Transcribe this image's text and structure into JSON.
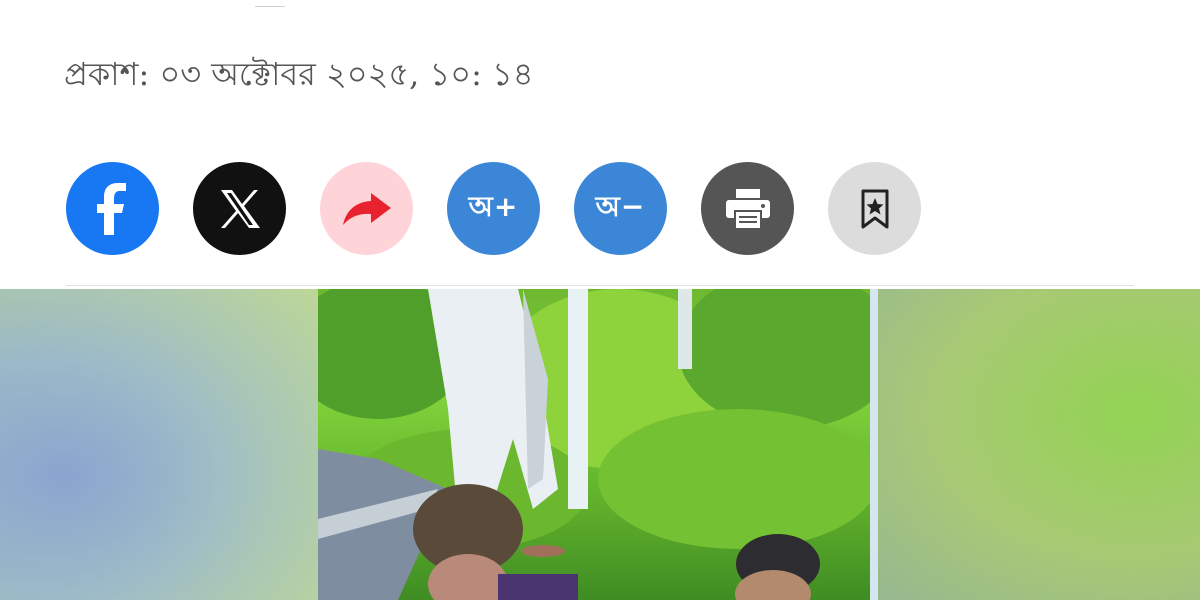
{
  "article": {
    "published_label": "প্রকাশ: ০৩ অক্টোবর ২০২৫, ১০: ১৪"
  },
  "share_bar": {
    "buttons": [
      {
        "name": "facebook",
        "icon": "facebook-icon",
        "color": "#1877f2"
      },
      {
        "name": "x",
        "icon": "x-icon",
        "color": "#111111"
      },
      {
        "name": "share",
        "icon": "share-arrow-icon",
        "color": "#ffd4d8"
      },
      {
        "name": "font-increase",
        "label": "অ+",
        "color": "#3b86d7"
      },
      {
        "name": "font-decrease",
        "label": "অ−",
        "color": "#3b86d7"
      },
      {
        "name": "print",
        "icon": "printer-icon",
        "color": "#555555"
      },
      {
        "name": "bookmark",
        "icon": "bookmark-star-icon",
        "color": "#dcdcdc"
      }
    ]
  },
  "hero_image": {
    "description_colors": [
      "#7f9fc6",
      "#9bd45a"
    ]
  }
}
